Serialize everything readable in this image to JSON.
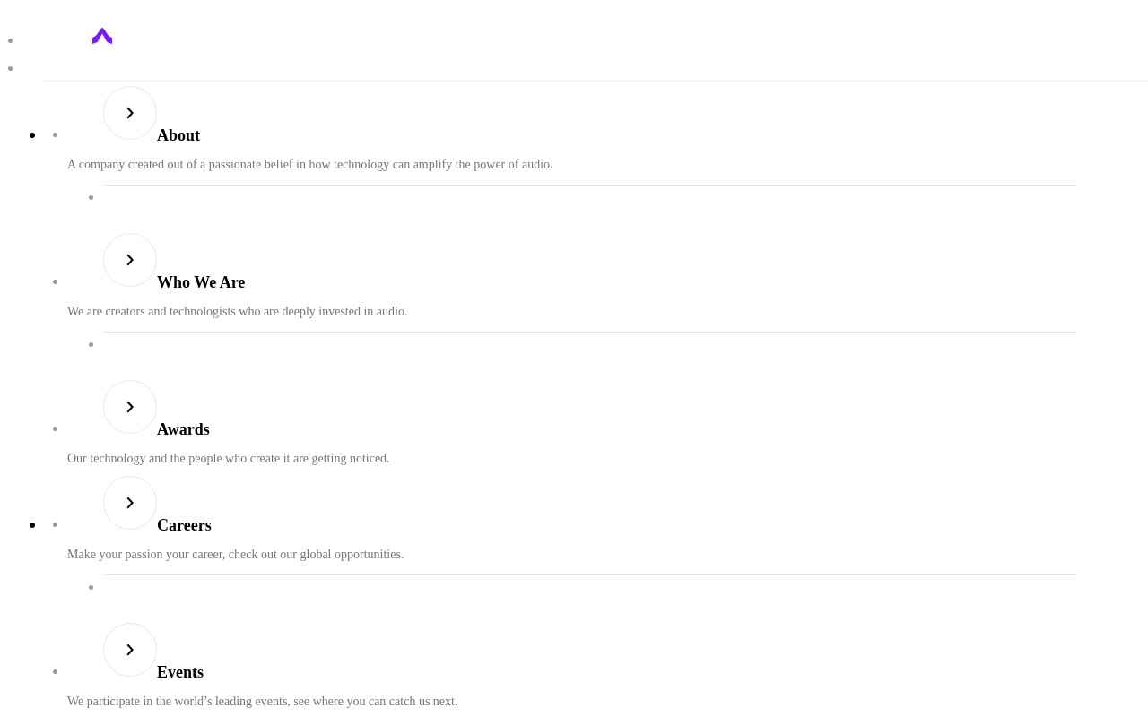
{
  "menu_groups": [
    {
      "items": [
        {
          "title": "About",
          "description": "A company created out of a passionate belief in how technology can amplify the power of audio.",
          "divider": true
        },
        {
          "title": "Who We Are",
          "description": "We are creators and technologists who are deeply invested in audio.",
          "divider": true
        },
        {
          "title": "Awards",
          "description": "Our technology and the people who create it are getting noticed.",
          "divider": false
        }
      ]
    },
    {
      "items": [
        {
          "title": "Careers",
          "description": "Make your passion your career, check out our global opportunities.",
          "divider": true
        },
        {
          "title": "Events",
          "description": "We participate in the world’s leading events, see where you can catch us next.",
          "divider": false
        }
      ]
    }
  ]
}
